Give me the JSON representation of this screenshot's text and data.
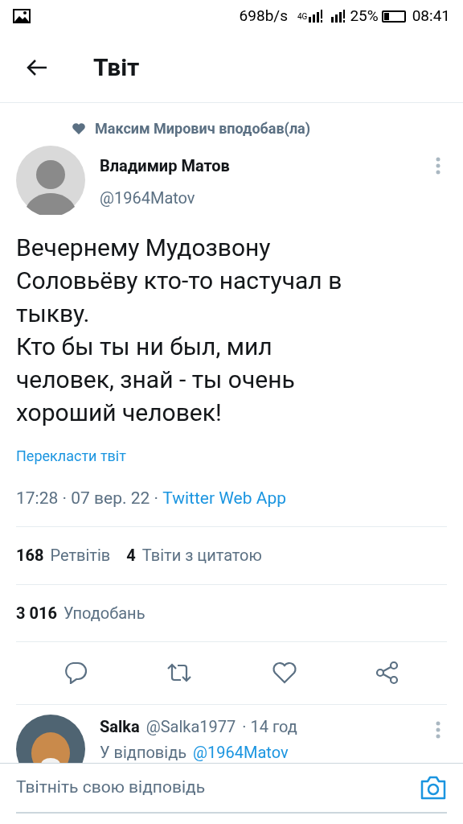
{
  "status_bar": {
    "speed": "698b/s",
    "network": "4G",
    "battery": "25%",
    "time": "08:41"
  },
  "header": {
    "title": "Твіт"
  },
  "tweet": {
    "liked_by": "Максим Мирович вподобав(ла)",
    "author": "Владимир Матов",
    "handle": "@1964Matov",
    "text": [
      "Вечернему Мудозвону Соловьёву кто-то настучал в тыкву.",
      "Кто бы ты ни был, мил человек, знай - ты очень хороший человек!"
    ],
    "translate": "Перекласти твіт",
    "time": "17:28 · 07 вер. 22 · ",
    "source": "Twitter Web App",
    "stats": [
      {
        "count": "168",
        "label": "Ретвітів"
      },
      {
        "count": "4",
        "label": "Твіти з цитатою"
      }
    ],
    "likes": {
      "count": "3 016",
      "label": "Уподобань"
    }
  },
  "reply": {
    "name": "Salka",
    "handle": "@Salka1977",
    "time": "· 14 год",
    "reply_to": "У відповідь",
    "mention": "@1964Matov"
  },
  "composer": {
    "placeholder": "Твітніть свою відповідь"
  }
}
